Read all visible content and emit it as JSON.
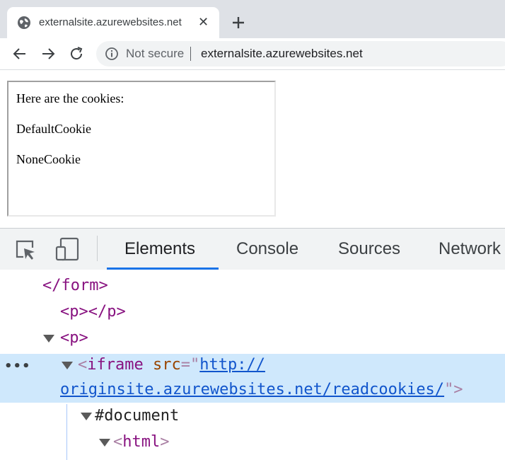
{
  "browser": {
    "tab": {
      "title": "externalsite.azurewebsites.net",
      "close_glyph": "✕"
    },
    "omnibox": {
      "security_label": "Not secure",
      "url": "externalsite.azurewebsites.net"
    }
  },
  "page": {
    "heading": "Here are the cookies:",
    "cookies": [
      "DefaultCookie",
      "NoneCookie"
    ]
  },
  "devtools": {
    "tabs": [
      "Elements",
      "Console",
      "Sources",
      "Network"
    ],
    "active_tab": "Elements",
    "dom": {
      "form_close": "</form>",
      "p_empty_open": "<p>",
      "p_empty_close": "</p>",
      "p_open": "<p>",
      "iframe_tag": "iframe",
      "iframe_attr": "src",
      "iframe_src_part1": "http://",
      "iframe_src_part2": "originsite.azurewebsites.net/readcookies/",
      "document_node": "#document",
      "html_tag": "html",
      "selected_dots": "•••"
    }
  },
  "colors": {
    "accent": "#1a73e8",
    "selection": "#cfe8fc",
    "tag": "#881280",
    "attr": "#994500"
  },
  "icons": [
    "globe-icon",
    "close-icon",
    "plus-icon",
    "back-arrow-icon",
    "forward-arrow-icon",
    "reload-icon",
    "info-icon",
    "inspect-element-icon",
    "device-toggle-icon",
    "expand-triangle-icon"
  ]
}
